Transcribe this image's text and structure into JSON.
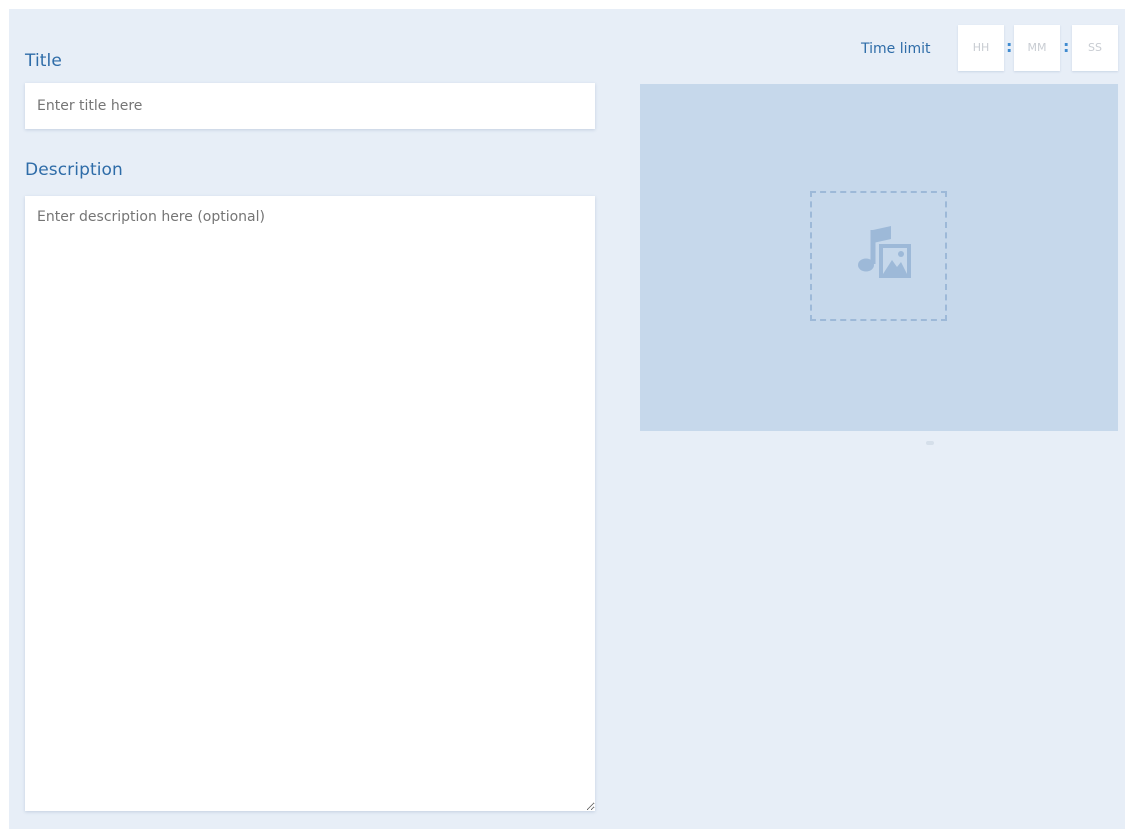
{
  "form": {
    "title_label": "Title",
    "title_placeholder": "Enter title here",
    "description_label": "Description",
    "description_placeholder": "Enter description here (optional)"
  },
  "time_limit": {
    "label": "Time limit",
    "hours_placeholder": "HH",
    "minutes_placeholder": "MM",
    "seconds_placeholder": "SS",
    "separator": ":"
  },
  "media": {
    "icon": "media-upload-icon"
  },
  "colors": {
    "label": "#2e6ca8",
    "panel_background": "#e7eef7",
    "media_area": "#c6d8eb",
    "dashed_border": "#9db9d8"
  }
}
